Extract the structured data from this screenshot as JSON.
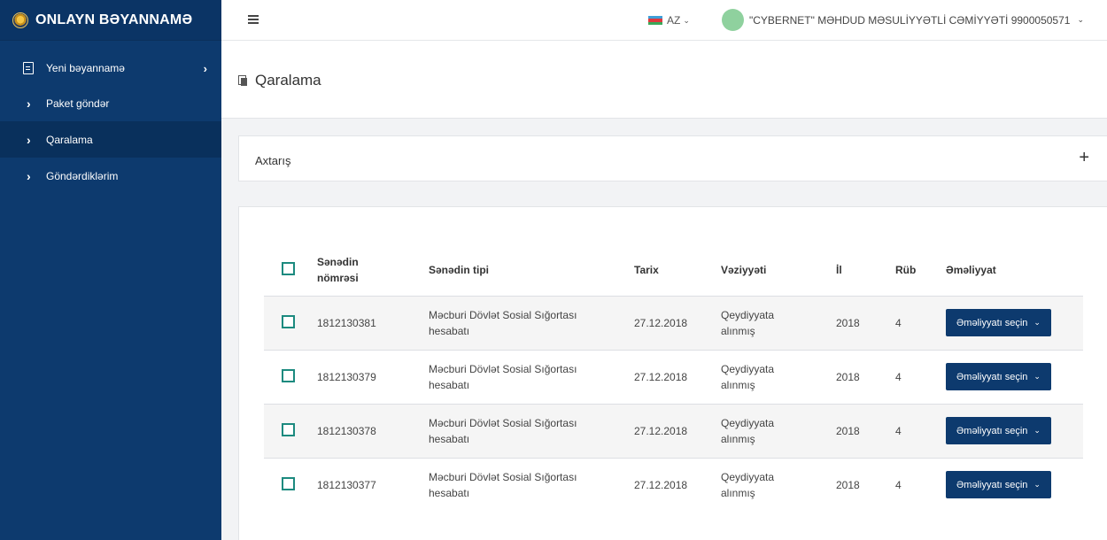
{
  "app": {
    "title": "ONLAYN BƏYANNAMƏ"
  },
  "sidebar": {
    "items": [
      {
        "label": "Yeni bəyannamə",
        "icon": "document-icon",
        "has_submenu": true,
        "active": false
      },
      {
        "label": "Paket göndər",
        "icon": "chevron-right-icon",
        "active": false
      },
      {
        "label": "Qaralama",
        "icon": "chevron-right-icon",
        "active": true
      },
      {
        "label": "Göndərdiklərim",
        "icon": "chevron-right-icon",
        "active": false
      }
    ]
  },
  "topbar": {
    "language": "AZ",
    "user": "\"CYBERNET\" MƏHDUD MƏSULİYYƏTLİ CƏMİYYƏTİ 9900050571"
  },
  "page": {
    "title": "Qaralama"
  },
  "search": {
    "label": "Axtarış",
    "toggle": "+"
  },
  "table": {
    "headers": {
      "number_line1": "Sənədin",
      "number_line2": "nömrəsi",
      "type": "Sənədin tipi",
      "date": "Tarix",
      "state": "Vəziyyəti",
      "year": "İl",
      "quarter": "Rüb",
      "action": "Əməliyyat"
    },
    "rows": [
      {
        "number": "1812130381",
        "type_line1": "Məcburi Dövlət Sosial Sığortası",
        "type_line2": "hesabatı",
        "date": "27.12.2018",
        "state_line1": "Qeydiyyata",
        "state_line2": "alınmış",
        "year": "2018",
        "quarter": "4",
        "action": "Əməliyyatı seçin"
      },
      {
        "number": "1812130379",
        "type_line1": "Məcburi Dövlət Sosial Sığortası",
        "type_line2": "hesabatı",
        "date": "27.12.2018",
        "state_line1": "Qeydiyyata",
        "state_line2": "alınmış",
        "year": "2018",
        "quarter": "4",
        "action": "Əməliyyatı seçin"
      },
      {
        "number": "1812130378",
        "type_line1": "Məcburi Dövlət Sosial Sığortası",
        "type_line2": "hesabatı",
        "date": "27.12.2018",
        "state_line1": "Qeydiyyata",
        "state_line2": "alınmış",
        "year": "2018",
        "quarter": "4",
        "action": "Əməliyyatı seçin"
      },
      {
        "number": "1812130377",
        "type_line1": "Məcburi Dövlət Sosial Sığortası",
        "type_line2": "hesabatı",
        "date": "27.12.2018",
        "state_line1": "Qeydiyyata",
        "state_line2": "alınmış",
        "year": "2018",
        "quarter": "4",
        "action": "Əməliyyatı seçin"
      }
    ]
  },
  "colors": {
    "sidebar": "#0d3a6e",
    "accent": "#0d3a6e",
    "checkbox": "#1c8a7f",
    "avatar": "#8fd19e"
  }
}
